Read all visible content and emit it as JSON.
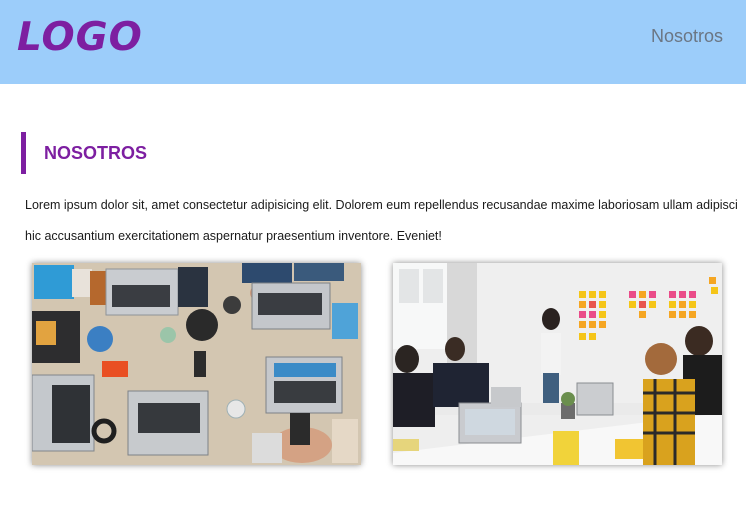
{
  "header": {
    "logo": "LOGO",
    "nav": {
      "link": "Nosotros"
    }
  },
  "section": {
    "title": "NOSOTROS",
    "line1": "Lorem ipsum dolor sit, amet consectetur adipisicing elit. Dolorem eum repellendus recusandae maxime laboriosam ullam adipisci",
    "line2": "hic accusantium exercitationem aspernatur praesentium inventore. Eveniet!"
  },
  "colors": {
    "header_bg": "#9ccdfa",
    "brand_purple": "#7d1fa1",
    "nav_text": "#6b7683"
  }
}
